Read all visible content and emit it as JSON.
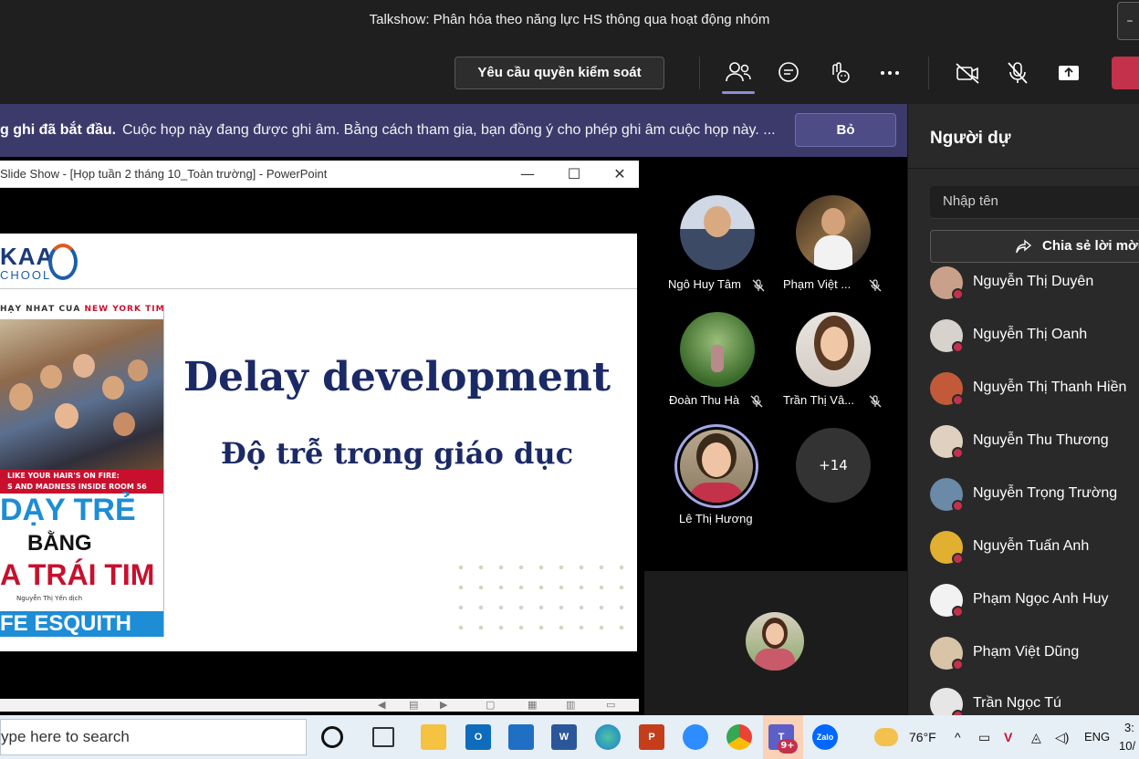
{
  "window": {
    "title": "Talkshow: Phân hóa theo năng lực HS thông qua hoạt động nhóm",
    "minimize_glyph": "–"
  },
  "toolbar": {
    "request_control_label": "Yêu cầu quyền kiểm soát",
    "icons": [
      "people-icon",
      "chat-icon",
      "reactions-icon",
      "more-icon",
      "camera-off-icon",
      "mic-off-icon",
      "share-icon",
      "leave-icon"
    ]
  },
  "banner": {
    "bold_text": "g ghi đã bắt đầu.",
    "message": "Cuộc họp này đang được ghi âm. Bằng cách tham gia, bạn đồng ý cho phép ghi âm cuộc họp này. ...",
    "dismiss_label": "Bỏ"
  },
  "ppt": {
    "window_title": "Slide Show - [Họp tuần 2 tháng 10_Toàn trường] - PowerPoint",
    "slide": {
      "logo_text": "KAA",
      "logo_sub": "CHOOL",
      "title": "Delay development",
      "subtitle": "Độ trễ trong giáo dục",
      "book": {
        "top_text_a": "HẠY NHẤT CỦA ",
        "top_text_b": "NEW YORK TIMES",
        "band_line1": "LIKE YOUR HAIR'S ON FIRE:",
        "band_line2": "S AND MADNESS INSIDE ROOM 56",
        "title_line1": "DẠY TRẺ",
        "title_line2": "BẰNG",
        "title_line3": "A TRÁI TIM",
        "translator": "Nguyễn Thị Yến dịch",
        "author": "FE ESQUITH"
      }
    }
  },
  "participants": [
    {
      "name": "Ngô Huy Tâm",
      "muted": true
    },
    {
      "name": "Phạm Việt ...",
      "muted": true
    },
    {
      "name": "Đoàn Thu Hà",
      "muted": true
    },
    {
      "name": "Trần Thị Vâ...",
      "muted": true
    },
    {
      "name": "Lê Thị Hương",
      "muted": false,
      "speaking": true
    }
  ],
  "overflow_count": "+14",
  "people_panel": {
    "title": "Người dự",
    "search_placeholder": "Nhập tên",
    "share_label": "Chia sẻ lời mời",
    "people": [
      {
        "name": "Nguyễn Thị Duyên",
        "color": "#c9a08a"
      },
      {
        "name": "Nguyễn Thị Oanh",
        "color": "#d8d2cc"
      },
      {
        "name": "Nguyễn Thị Thanh Hiền",
        "color": "#c25a3a"
      },
      {
        "name": "Nguyễn Thu Thương",
        "color": "#e0d0c0"
      },
      {
        "name": "Nguyễn Trọng Trường",
        "color": "#6a8aa8"
      },
      {
        "name": "Nguyễn Tuấn Anh",
        "color": "#e2b030"
      },
      {
        "name": "Phạm Ngọc Anh Huy",
        "color": "#f2f2f2"
      },
      {
        "name": "Phạm Việt Dũng",
        "color": "#d9c4a8"
      },
      {
        "name": "Trần Ngọc Tú",
        "color": "#e6e6e6"
      }
    ]
  },
  "taskbar": {
    "search_placeholder": "ype here to search",
    "temperature": "76°F",
    "language": "ENG",
    "time": "3:",
    "date": "10/",
    "teams_badge": "9+",
    "zalo_label": "Zalo"
  },
  "colors": {
    "banner_bg": "#3b3a6b",
    "accent": "#8c8fd6",
    "leave": "#c4314b",
    "slide_title": "#1b2a66"
  }
}
